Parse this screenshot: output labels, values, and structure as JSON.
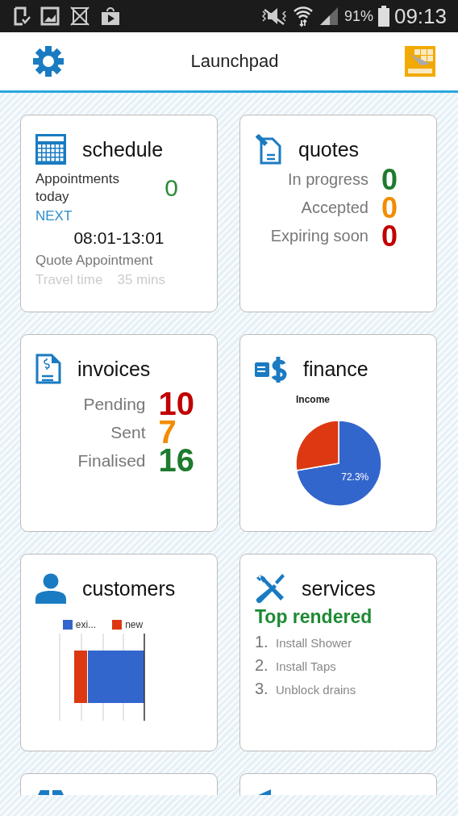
{
  "status_bar": {
    "battery": "91%",
    "time": "09:13"
  },
  "header": {
    "title": "Launchpad"
  },
  "tiles": [
    {
      "kind": "schedule",
      "title": "schedule",
      "appointments_label": "Appointments today",
      "appointments_count": "0",
      "next_label": "NEXT",
      "next_time": "08:01-13:01",
      "next_type": "Quote Appointment",
      "travel_label": "Travel time",
      "travel_value": "35 mins"
    },
    {
      "kind": "stats",
      "title": "quotes",
      "stats": [
        {
          "label": "In progress",
          "value": "0",
          "color": "#1e7b2e"
        },
        {
          "label": "Accepted",
          "value": "0",
          "color": "#f28c00"
        },
        {
          "label": "Expiring soon",
          "value": "0",
          "color": "#c10000"
        }
      ]
    },
    {
      "kind": "stats",
      "title": "invoices",
      "stats": [
        {
          "label": "Pending",
          "value": "10",
          "color": "#c10000"
        },
        {
          "label": "Sent",
          "value": "7",
          "color": "#f28c00"
        },
        {
          "label": "Finalised",
          "value": "16",
          "color": "#1e7b2e"
        }
      ]
    },
    {
      "kind": "pie",
      "title": "finance",
      "chart_data": {
        "type": "pie",
        "title": "Income",
        "series": [
          {
            "values": [
              72.3,
              27.7
            ]
          }
        ],
        "value_labels": [
          "72.3%",
          null
        ]
      }
    },
    {
      "kind": "legend_bar",
      "title": "customers",
      "legend": [
        {
          "label": "exi...",
          "color": "#3366cc"
        },
        {
          "label": "new",
          "color": "#dc3912"
        }
      ]
    },
    {
      "kind": "ranking",
      "title": "services",
      "subtitle": "Top rendered",
      "items": [
        {
          "rank": "1.",
          "label": "Install Shower"
        },
        {
          "rank": "2.",
          "label": "Install Taps"
        },
        {
          "rank": "3.",
          "label": "Unblock drains"
        }
      ]
    },
    {
      "kind": "partial"
    },
    {
      "kind": "partial"
    }
  ]
}
